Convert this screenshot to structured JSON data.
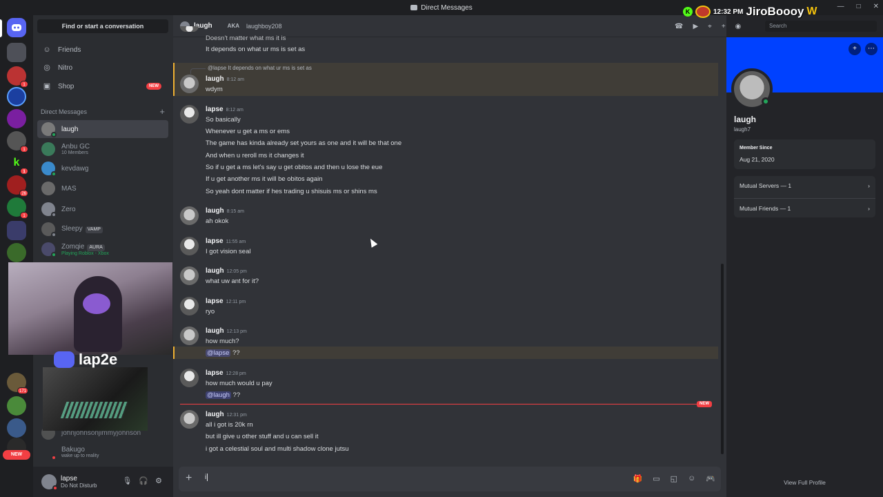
{
  "window": {
    "title": "Direct Messages",
    "controls": [
      "—",
      "□",
      "✕"
    ]
  },
  "sidebar": {
    "search_label": "Find or start a conversation",
    "nav": [
      {
        "label": "Friends",
        "icon": "friends-icon",
        "glyph": "☺"
      },
      {
        "label": "Nitro",
        "icon": "nitro-icon",
        "glyph": "◎"
      },
      {
        "label": "Shop",
        "icon": "shop-icon",
        "glyph": "▣",
        "badge": "NEW"
      }
    ],
    "dm_header": "Direct Messages",
    "dms": [
      {
        "name": "laugh",
        "sub": "",
        "tag": "",
        "status": "online"
      },
      {
        "name": "Anbu GC",
        "sub": "10 Members",
        "tag": "",
        "status": ""
      },
      {
        "name": "kevdawg",
        "sub": "",
        "tag": "",
        "status": "online"
      },
      {
        "name": "MAS",
        "sub": "",
        "tag": "",
        "status": ""
      },
      {
        "name": "Zero",
        "sub": "",
        "tag": "",
        "status": "offline"
      },
      {
        "name": "Sleepy",
        "sub": "",
        "tag": "VAMP",
        "status": "offline"
      },
      {
        "name": "Zomqie",
        "sub": "Playing Roblox - Xbox",
        "tag": "AURA",
        "status": "online"
      }
    ],
    "hidden_dms": [
      {
        "name": "johnjohnsonjimmyjohnson",
        "sub": ""
      },
      {
        "name": "Bakugo",
        "sub": "wake up to reality"
      }
    ],
    "overlay_name": "lap2e",
    "user": {
      "name": "lapse",
      "status": "Do Not Disturb"
    },
    "rail_badges": [
      "1",
      "1",
      "1",
      "26",
      "1",
      "171",
      "46",
      "NEW"
    ]
  },
  "chat": {
    "header": {
      "name": "laugh",
      "aka": "AKA",
      "alias": "laughboy208"
    },
    "messages": [
      {
        "lines": [
          "Doesn't matter what ms it is",
          "It depends on what ur ms is set as"
        ]
      },
      {
        "author": "laugh",
        "time": "8:12 am",
        "reply": "@lapse It depends on what ur ms is set as",
        "lines": [
          "wdym"
        ]
      },
      {
        "author": "lapse",
        "time": "8:12 am",
        "lines": [
          "So basically",
          "Whenever u get a ms or ems",
          "The game has kinda already set yours as one and it will be that one",
          "And when u reroll ms it changes it",
          "So if u get a ms let's say u get obitos and then u lose the eue",
          "If u get another ms it will be obitos again",
          "So yeah dont matter if hes trading u shisuis ms or shins ms"
        ]
      },
      {
        "author": "laugh",
        "time": "8:15 am",
        "lines": [
          "ah okok"
        ]
      },
      {
        "author": "lapse",
        "time": "11:55 am",
        "lines": [
          "I got vision seal"
        ]
      },
      {
        "author": "laugh",
        "time": "12:05 pm",
        "lines": [
          "what uw ant for it?"
        ]
      },
      {
        "author": "lapse",
        "time": "12:11 pm",
        "lines": [
          "ryo"
        ]
      },
      {
        "author": "laugh",
        "time": "12:13 pm",
        "lines": [
          "how much?"
        ],
        "mention": "@lapse",
        "mention_rest": " ??"
      },
      {
        "author": "lapse",
        "time": "12:28 pm",
        "lines": [
          "how much would u pay"
        ],
        "mention": "@laugh",
        "mention_rest": " ??"
      },
      {
        "author": "laugh",
        "time": "12:31 pm",
        "lines": [
          "all i got is 20k rn",
          "but ill give u other stuff and u can sell it",
          "i got a celestial soul and multi shadow clone jutsu"
        ]
      }
    ],
    "new_label": "NEW",
    "composer_value": "i"
  },
  "profile": {
    "display_name": "laugh",
    "username": "laugh7",
    "member_since_label": "Member Since",
    "member_since": "Aug 21, 2020",
    "mutual_servers": "Mutual Servers — 1",
    "mutual_friends": "Mutual Friends — 1",
    "view_full": "View Full Profile",
    "search_placeholder": "Search"
  },
  "overlay": {
    "time": "12:32 PM",
    "name": "JiroBoooy",
    "k": "K",
    "w": "W"
  },
  "colors": {
    "accent": "#5865f2",
    "banner": "#0041ff",
    "online": "#23a55a",
    "dnd": "#f23f43",
    "mention": "#f0b132"
  }
}
